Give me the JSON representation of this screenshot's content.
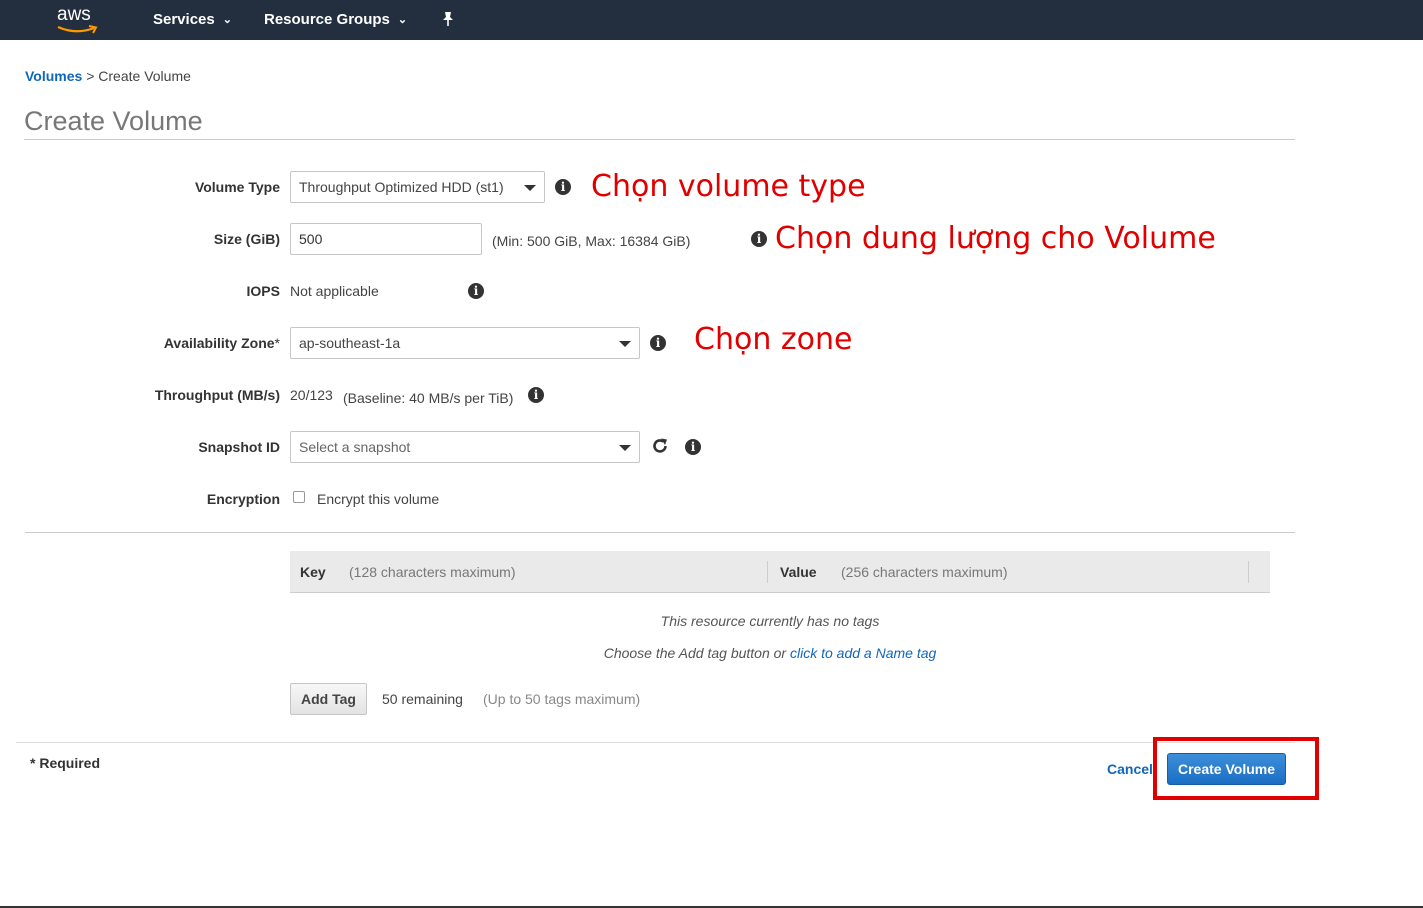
{
  "nav": {
    "logo_text": "aws",
    "services_label": "Services",
    "resource_groups_label": "Resource Groups",
    "pin_icon": "pin-icon",
    "chevron_icon": "chevron-down-icon"
  },
  "breadcrumb": {
    "parent": "Volumes",
    "separator": ">",
    "current": "Create Volume"
  },
  "page_title": "Create Volume",
  "form": {
    "volume_type": {
      "label": "Volume Type",
      "value": "Throughput Optimized HDD (st1)"
    },
    "size": {
      "label": "Size (GiB)",
      "value": "500",
      "hint": "(Min: 500 GiB, Max: 16384 GiB)"
    },
    "iops": {
      "label": "IOPS",
      "value": "Not applicable"
    },
    "availability_zone": {
      "label": "Availability Zone",
      "required_mark": "*",
      "value": "ap-southeast-1a"
    },
    "throughput": {
      "label": "Throughput (MB/s)",
      "value": "20/123",
      "hint": "(Baseline: 40 MB/s per TiB)"
    },
    "snapshot": {
      "label": "Snapshot ID",
      "placeholder": "Select a snapshot"
    },
    "encryption": {
      "label": "Encryption",
      "checkbox_label": "Encrypt this volume",
      "checked": false
    }
  },
  "annotations": {
    "volume_type": "Chọn volume type",
    "size": "Chọn dung lượng cho Volume",
    "zone": "Chọn zone",
    "color": "#e00000"
  },
  "tags": {
    "key_header": "Key",
    "key_hint": "(128 characters maximum)",
    "value_header": "Value",
    "value_hint": "(256 characters maximum)",
    "empty_message": "This resource currently has no tags",
    "choose_text": "Choose the Add tag button or",
    "name_tag_link": "click to add a Name tag",
    "add_tag_label": "Add Tag",
    "remaining": "50 remaining",
    "max_note": "(Up to 50 tags maximum)"
  },
  "footer": {
    "required_note": "* Required",
    "cancel_label": "Cancel",
    "create_label": "Create Volume"
  },
  "colors": {
    "nav_bg": "#232f3e",
    "link": "#1166bb",
    "primary_button": "#1a6ec3",
    "annotation_red": "#e00000"
  }
}
